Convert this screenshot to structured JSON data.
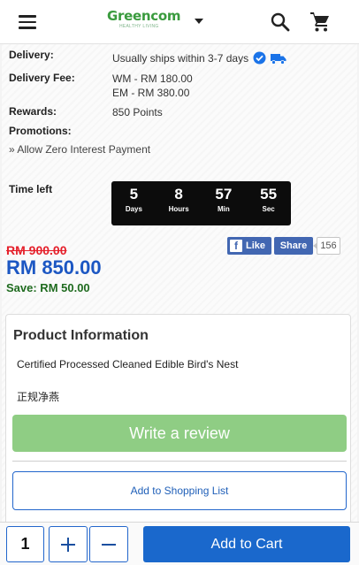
{
  "header": {
    "logo_text": "Greencom",
    "logo_tagline": "HEALTHY LIVING"
  },
  "details": {
    "delivery_label": "Delivery:",
    "delivery_value": "Usually ships within 3-7 days",
    "delivery_fee_label": "Delivery Fee:",
    "delivery_fee_lines": [
      "WM - RM 180.00",
      "EM - RM 380.00"
    ],
    "rewards_label": "Rewards:",
    "rewards_value": "850 Points",
    "promotions_label": "Promotions:",
    "promotion_link": "» Allow Zero Interest Payment"
  },
  "timer": {
    "label": "Time left",
    "units": [
      {
        "value": "5",
        "label": "Days"
      },
      {
        "value": "8",
        "label": "Hours"
      },
      {
        "value": "57",
        "label": "Min"
      },
      {
        "value": "55",
        "label": "Sec"
      }
    ]
  },
  "pricing": {
    "old_price": "RM 900.00",
    "new_price": "RM 850.00",
    "save": "Save: RM 50.00"
  },
  "social": {
    "like_label": "Like",
    "share_label": "Share",
    "share_count": "156"
  },
  "product_info": {
    "title": "Product Information",
    "line1": "Certified Processed Cleaned Edible Bird's Nest",
    "line2": "正规净燕",
    "review_button": "Write a review",
    "shopping_list_button": "Add to Shopping List"
  },
  "bottom": {
    "quantity": "1",
    "add_to_cart": "Add to Cart"
  },
  "colors": {
    "brand_green": "#3a9b3e",
    "price_blue": "#1c57c3",
    "old_price_red": "#e5202b",
    "save_green": "#1f6b1f",
    "cart_blue": "#1a68cc",
    "review_green": "#8fcd84",
    "facebook_blue": "#4267b2"
  }
}
